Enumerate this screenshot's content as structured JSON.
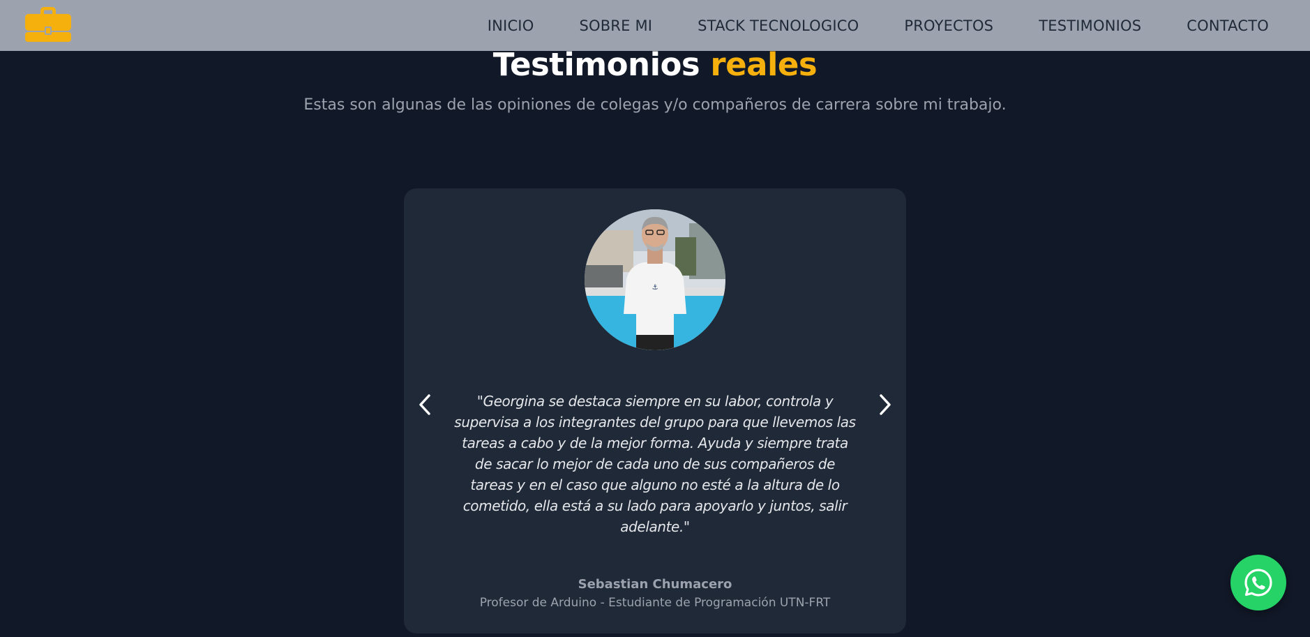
{
  "nav": {
    "links": [
      "INICIO",
      "SOBRE MI",
      "STACK TECNOLOGICO",
      "PROYECTOS",
      "TESTIMONIOS",
      "CONTACTO"
    ]
  },
  "section": {
    "title_main": "Testimonios",
    "title_accent": "reales",
    "subtitle": "Estas son algunas de las opiniones de colegas y/o compañeros de carrera sobre mi trabajo."
  },
  "testimonial": {
    "quote": "\"Georgina se destaca siempre en su labor, controla y supervisa a los integrantes del grupo para que llevemos las tareas a cabo y de la mejor forma. Ayuda y siempre trata de sacar lo mejor de cada uno de sus compañeros de tareas y en el caso que alguno no esté a la altura de lo cometido, ella está a su lado para apoyarlo y juntos, salir adelante.\"",
    "author_name": "Sebastian Chumacero",
    "author_role": "Profesor de Arduino - Estudiante de Programación UTN-FRT"
  },
  "icons": {
    "logo": "briefcase-icon",
    "prev": "chevron-left-icon",
    "next": "chevron-right-icon",
    "floating": "whatsapp-icon"
  },
  "colors": {
    "background": "#111827",
    "navbar": "#9ca3af",
    "card": "#1f2937",
    "accent": "#f5b00d",
    "whatsapp": "#25d366"
  }
}
